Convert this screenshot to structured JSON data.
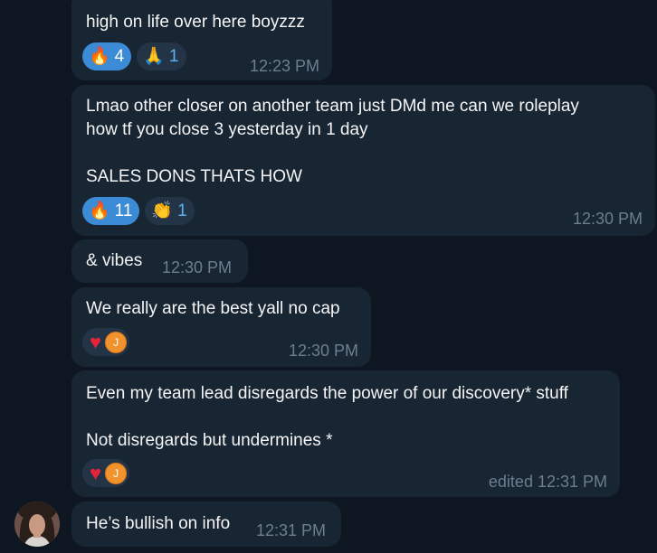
{
  "messages": [
    {
      "text": "high on life over here boyzzz",
      "time": "12:23 PM",
      "reactions": [
        {
          "emoji": "🔥",
          "count": "4",
          "mine": true
        },
        {
          "emoji": "🙏",
          "count": "1",
          "mine": false
        }
      ]
    },
    {
      "text": "Lmao other closer on another team just DMd me can we roleplay\nhow tf you close 3 yesterday in 1 day\n\nSALES DONS THATS HOW",
      "time": "12:30 PM",
      "reactions": [
        {
          "emoji": "🔥",
          "count": "11",
          "mine": true
        },
        {
          "emoji": "👏",
          "count": "1",
          "mine": false
        }
      ]
    },
    {
      "text": "& vibes",
      "time": "12:30 PM"
    },
    {
      "text": "We really are the best yall no cap",
      "time": "12:30 PM",
      "reaction": {
        "emoji": "♥",
        "avatar_initial": "J"
      }
    },
    {
      "text": "Even my team lead disregards the power of our discovery* stuff\n\nNot disregards but undermines *",
      "time": "edited 12:31 PM",
      "reaction": {
        "emoji": "♥",
        "avatar_initial": "J"
      }
    },
    {
      "text": "He’s bullish on info",
      "time": "12:31 PM"
    }
  ],
  "colors": {
    "background": "#0e1621",
    "bubble": "#182533",
    "accent": "#3b8bd6",
    "heart": "#e5233a"
  }
}
